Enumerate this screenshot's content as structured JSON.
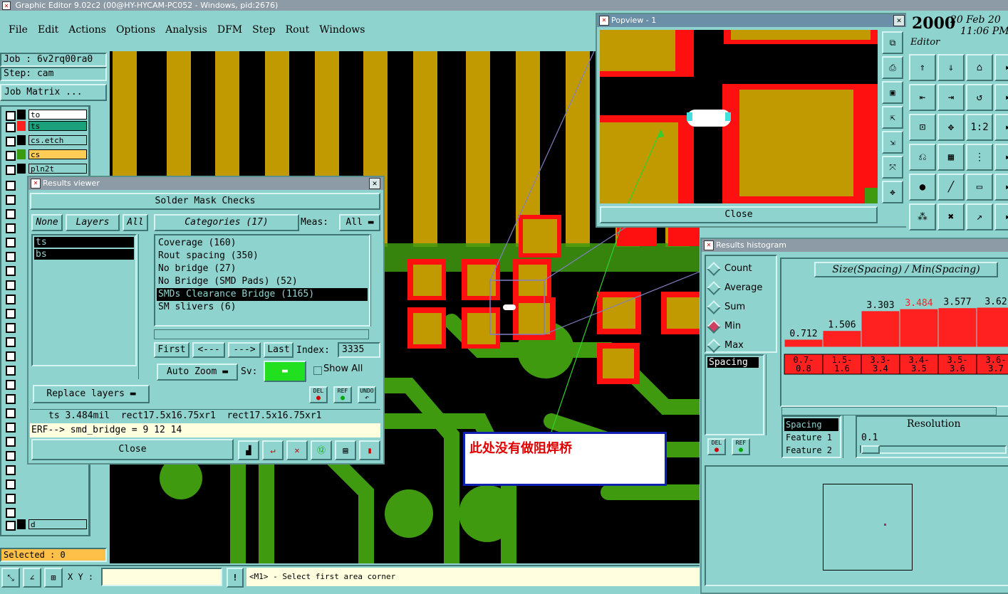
{
  "window": {
    "title": "Graphic Editor 9.02c2 (00@HY-HYCAM-PC052 - Windows, pid:2676)"
  },
  "menu": [
    "File",
    "Edit",
    "Actions",
    "Options",
    "Analysis",
    "DFM",
    "Step",
    "Rout",
    "Windows"
  ],
  "clock": {
    "year": "2000",
    "date": "20 Feb 20",
    "time": "11:06 PM",
    "label": "Editor"
  },
  "job": {
    "job_label": "Job : 6v2rq00ra0",
    "step_label": "Step: cam",
    "matrix_button": "Job Matrix ..."
  },
  "layers": [
    {
      "name": "to",
      "color": "#ffffff",
      "swatch": "#000000"
    },
    {
      "name": "ts",
      "color": "#1aa07a",
      "swatch": "#ff2020"
    },
    {
      "name": "cs.etch",
      "color": "#8fd3cf",
      "swatch": "#000000"
    },
    {
      "name": "cs",
      "color": "#ffcc55",
      "swatch": "#3a9a10"
    },
    {
      "name": "pln2t",
      "color": "#8fd3cf",
      "swatch": "#000000"
    },
    {
      "name": "d",
      "color": "#8fd3cf",
      "swatch": "#000000"
    }
  ],
  "status": {
    "selected": "Selected : 0",
    "xy_label": "X Y :",
    "xy_value": "",
    "prompt": "<M1> - Select first area corner"
  },
  "results_viewer": {
    "title": "Results viewer",
    "header": "Solder Mask Checks",
    "none_btn": "None",
    "layers_btn": "Layers",
    "all_btn": "All",
    "categories_btn": "Categories (17)",
    "meas_label": "Meas:",
    "meas_value": "All",
    "layer_items": [
      "ts",
      "bs"
    ],
    "categories": [
      "Coverage (160)",
      "Rout spacing (350)",
      "No bridge (27)",
      "No Bridge (SMD Pads) (52)",
      "SMDs Clearance Bridge (1165)",
      "SM slivers (6)"
    ],
    "selected_category": 4,
    "first_btn": "First",
    "prev_btn": "<---",
    "next_btn": "--->",
    "last_btn": "Last",
    "index_label": "Index:",
    "index_value": "3335",
    "zoom_btn": "Auto Zoom",
    "sv_label": "Sv:",
    "show_all": "Show All",
    "replace_btn": "Replace layers",
    "del_label": "DEL",
    "ref_label": "REF",
    "undo_label": "UNDO",
    "measure_line": "ts 3.484mil  rect17.5x16.75xr1  rect17.5x16.75xr1",
    "erf_line": "ERF--> smd_bridge = 9 12 14",
    "close_btn": "Close"
  },
  "popview": {
    "title": "Popview - 1",
    "close_btn": "Close"
  },
  "annotation": {
    "text": "此处没有做阻焊桥"
  },
  "histogram": {
    "title": "Results histogram",
    "modes": [
      "Count",
      "Average",
      "Sum",
      "Min",
      "Max"
    ],
    "selected_mode": "Min",
    "chart_title": "Size(Spacing) / Min(Spacing)",
    "list_item": "Spacing",
    "del_label": "DEL",
    "ref_label": "REF",
    "features": [
      "Spacing",
      "Feature 1",
      "Feature 2"
    ],
    "resolution_label": "Resolution",
    "resolution_value": "0.1",
    "chart_data": {
      "type": "bar",
      "categories": [
        "0.7-0.8",
        "1.5-1.6",
        "3.3-3.4",
        "3.4-3.5",
        "3.5-3.6",
        "3.6-3.7"
      ],
      "category_lines": [
        [
          "0.7-",
          "0.8"
        ],
        [
          "1.5-",
          "1.6"
        ],
        [
          "3.3-",
          "3.4"
        ],
        [
          "3.4-",
          "3.5"
        ],
        [
          "3.5-",
          "3.6"
        ],
        [
          "3.6-",
          "3.7"
        ]
      ],
      "values": [
        0.712,
        1.506,
        3.303,
        3.484,
        3.577,
        3.62
      ],
      "value_labels": [
        "0.712",
        "1.506",
        "3.303",
        "3.484",
        "3.577",
        "3.62"
      ],
      "highlight_index": 3,
      "highlight_color": "#ff2020",
      "bar_color": "#ff2020"
    }
  },
  "colors": {
    "panel": "#8fd3cf",
    "copper": "#c09a00",
    "green": "#3f9a10",
    "red": "#ff1010",
    "board": "#000000"
  }
}
